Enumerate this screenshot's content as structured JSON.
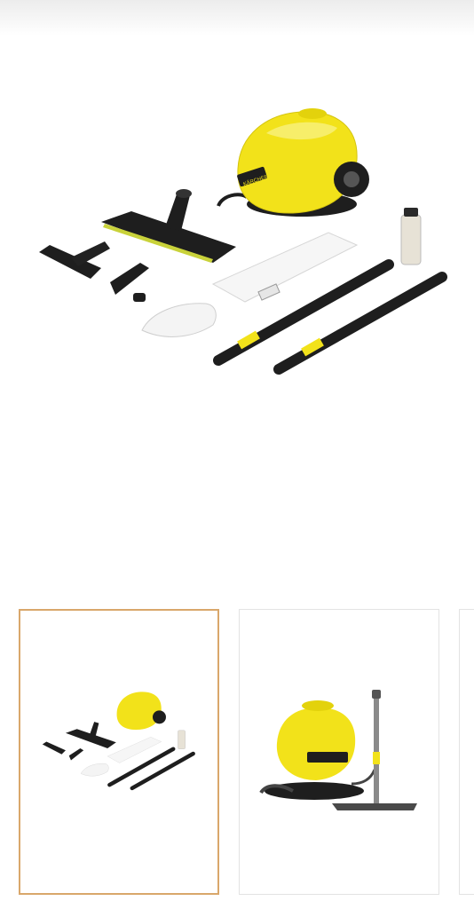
{
  "product_gallery": {
    "main_image": {
      "icon": "steam-cleaner-kit-image",
      "alt": ""
    },
    "brand_text": "KÄRCHER",
    "thumbnails": [
      {
        "icon": "steam-cleaner-kit-thumbnail",
        "selected": true
      },
      {
        "icon": "steam-cleaner-with-floor-tool-thumbnail",
        "selected": false
      },
      {
        "icon": "partial-thumbnail",
        "selected": false
      }
    ]
  },
  "colors": {
    "yellow": "#f2e21a",
    "black": "#1e1e1e",
    "selected_border": "#d9a76b"
  }
}
